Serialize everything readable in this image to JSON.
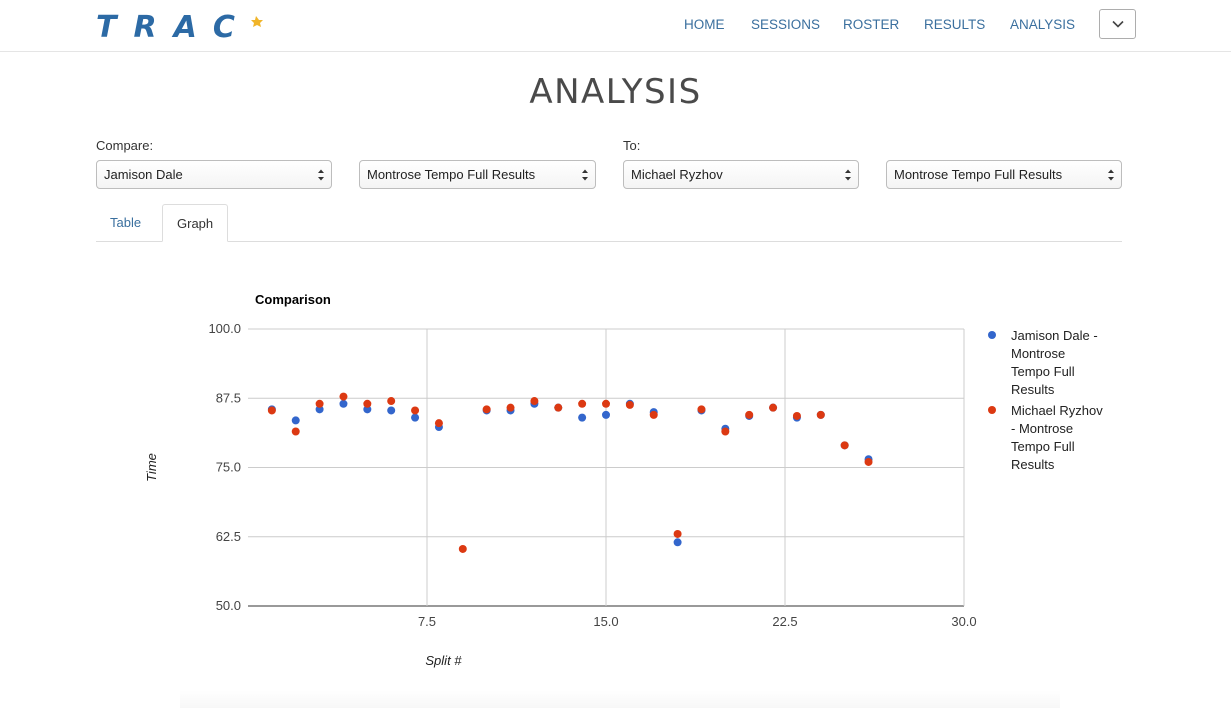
{
  "brand": {
    "name": "TRAC",
    "color": "#2c6aa5",
    "accent_icon": "runner-spark-icon"
  },
  "nav": {
    "items": [
      {
        "label": "HOME"
      },
      {
        "label": "SESSIONS"
      },
      {
        "label": "ROSTER"
      },
      {
        "label": "RESULTS"
      },
      {
        "label": "ANALYSIS"
      }
    ],
    "toggle_icon": "chevron-down-icon"
  },
  "page": {
    "title": "ANALYSIS"
  },
  "compare": {
    "compare_label": "Compare:",
    "to_label": "To:",
    "athlete_a": "Jamison Dale",
    "session_a": "Montrose Tempo Full Results",
    "athlete_b": "Michael Ryzhov",
    "session_b": "Montrose Tempo Full Results"
  },
  "tabs": [
    {
      "label": "Table",
      "active": false
    },
    {
      "label": "Graph",
      "active": true
    }
  ],
  "chart_data": {
    "type": "scatter",
    "title": "Comparison",
    "xlabel": "Split #",
    "ylabel": "Time",
    "xlim": [
      0.0,
      30.0
    ],
    "ylim": [
      50.0,
      100.0
    ],
    "x_ticks": [
      "7.5",
      "15.0",
      "22.5",
      "30.0"
    ],
    "y_ticks": [
      "50.0",
      "62.5",
      "75.0",
      "87.5",
      "100.0"
    ],
    "grid": true,
    "legend_position": "right",
    "series": [
      {
        "name": "Jamison Dale - Montrose Tempo Full Results",
        "legend_lines": [
          "Jamison Dale -",
          "Montrose",
          "Tempo Full",
          "Results"
        ],
        "color": "#3366cc",
        "x": [
          1,
          2,
          3,
          4,
          5,
          6,
          7,
          8,
          10,
          11,
          12,
          13,
          14,
          15,
          16,
          17,
          18,
          19,
          20,
          21,
          22,
          23,
          24,
          25,
          26
        ],
        "y": [
          85.5,
          83.5,
          85.5,
          86.5,
          85.5,
          85.3,
          84.0,
          82.3,
          85.3,
          85.3,
          86.5,
          85.8,
          84.0,
          84.5,
          86.5,
          85.0,
          61.5,
          85.3,
          82.0,
          84.3,
          85.8,
          84.0,
          84.5,
          79.0,
          76.5
        ],
        "ylim_note": ""
      },
      {
        "name": "Michael Ryzhov - Montrose Tempo Full Results",
        "legend_lines": [
          "Michael Ryzhov",
          "- Montrose",
          "Tempo Full",
          "Results"
        ],
        "color": "#dc3912",
        "x": [
          1,
          2,
          3,
          4,
          5,
          6,
          7,
          8,
          9,
          10,
          11,
          12,
          13,
          14,
          15,
          16,
          17,
          18,
          19,
          20,
          21,
          22,
          23,
          24,
          25,
          26
        ],
        "y": [
          85.3,
          81.5,
          86.5,
          87.8,
          86.5,
          87.0,
          85.3,
          83.0,
          60.3,
          85.5,
          85.8,
          87.0,
          85.8,
          86.5,
          86.5,
          86.3,
          84.5,
          63.0,
          85.5,
          81.5,
          84.5,
          85.8,
          84.3,
          84.5,
          79.0,
          76.0
        ]
      }
    ]
  }
}
